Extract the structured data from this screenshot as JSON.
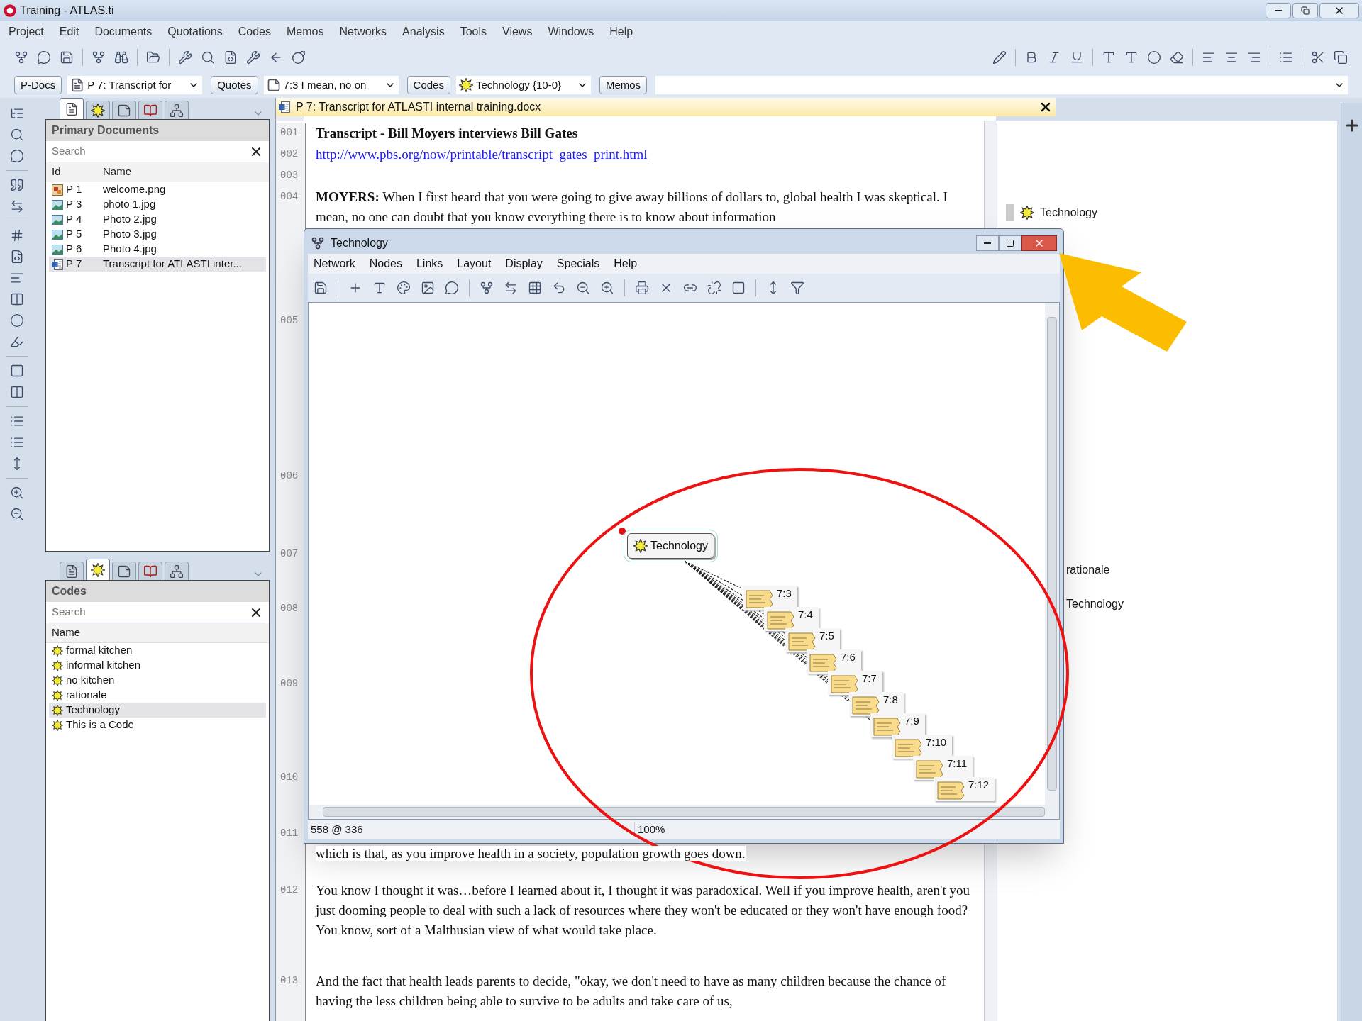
{
  "window": {
    "title": "Training - ATLAS.ti"
  },
  "menu": [
    "Project",
    "Edit",
    "Documents",
    "Quotations",
    "Codes",
    "Memos",
    "Networks",
    "Analysis",
    "Tools",
    "Views",
    "Windows",
    "Help"
  ],
  "selector_bar": [
    {
      "button": "P-Docs",
      "combo": "P 7: Transcript for"
    },
    {
      "button": "Quotes",
      "combo": "7:3 I mean, no on"
    },
    {
      "button": "Codes",
      "combo": "Technology {10-0}"
    },
    {
      "button": "Memos"
    }
  ],
  "primary_documents": {
    "tabs": [
      {
        "kind": "documents",
        "selected": true
      },
      {
        "kind": "codes",
        "selected": false
      },
      {
        "kind": "quotations",
        "selected": false
      },
      {
        "kind": "memos",
        "selected": false
      },
      {
        "kind": "networks",
        "selected": false
      }
    ],
    "title": "Primary Documents",
    "search": {
      "placeholder": "Search"
    },
    "columns": [
      "Id",
      "Name"
    ],
    "rows": [
      {
        "id": "P 1",
        "name": "welcome.png",
        "kind": "graphic",
        "selected": false
      },
      {
        "id": "P 3",
        "name": "photo 1.jpg",
        "kind": "image",
        "selected": false
      },
      {
        "id": "P 4",
        "name": "Photo 2.jpg",
        "kind": "image",
        "selected": false
      },
      {
        "id": "P 5",
        "name": "Photo 3.jpg",
        "kind": "image",
        "selected": false
      },
      {
        "id": "P 6",
        "name": "Photo 4.jpg",
        "kind": "image",
        "selected": false
      },
      {
        "id": "P 7",
        "name": "Transcript for ATLASTI inter...",
        "kind": "document",
        "selected": true
      }
    ]
  },
  "codes": {
    "tabs": [
      {
        "kind": "documents",
        "selected": false
      },
      {
        "kind": "codes",
        "selected": true
      },
      {
        "kind": "quotations",
        "selected": false
      },
      {
        "kind": "memos",
        "selected": false
      },
      {
        "kind": "networks",
        "selected": false
      }
    ],
    "title": "Codes",
    "search": {
      "placeholder": "Search"
    },
    "columns": [
      "Name"
    ],
    "rows": [
      {
        "name": "formal kitchen",
        "selected": false
      },
      {
        "name": "informal kitchen",
        "selected": false
      },
      {
        "name": "no kitchen",
        "selected": false
      },
      {
        "name": "rationale",
        "selected": false
      },
      {
        "name": "Technology",
        "selected": true
      },
      {
        "name": "This is a Code",
        "selected": false
      }
    ]
  },
  "document": {
    "title": "P 7: Transcript for ATLASTI internal training.docx",
    "lines": [
      {
        "number": "001",
        "kind": "heading",
        "text": "Transcript - Bill Moyers interviews Bill Gates"
      },
      {
        "number": "002",
        "kind": "link",
        "text": "http://www.pbs.org/now/printable/transcript_gates_print.html"
      },
      {
        "number": "003"
      },
      {
        "number": "004",
        "kind": "text",
        "text": "**MOYERS:** When I first heard that you were going to give away billions of dollars to, global health I was skeptical. I mean, no one can doubt that you know everything there is to know about information"
      },
      {
        "number": "005"
      },
      {
        "number": "006"
      },
      {
        "number": "007"
      },
      {
        "number": "008"
      },
      {
        "number": "009"
      },
      {
        "number": "010"
      },
      {
        "number": "011",
        "kind": "continued",
        "text": "which is that, as you improve health in a society, population growth goes down."
      },
      {
        "number": "012",
        "kind": "text",
        "text": "You know I thought it was…before I learned about it, I thought it was paradoxical. Well if you improve health, aren't you just dooming people to deal with such a lack of resources where they won't be educated or they won't have enough food? You know, sort of a Malthusian view of what would take place."
      },
      {
        "number": "013",
        "kind": "text",
        "text": "And the fact that health leads parents to decide, \"okay, we don't need to have as many children because the chance of having the less children being able to survive to be adults and take care of us,"
      }
    ]
  },
  "margin": [
    {
      "kind": "code",
      "text": "Technology"
    },
    {
      "kind": "plain",
      "text": "rationale"
    },
    {
      "kind": "plain",
      "text": "Technology"
    }
  ],
  "network_window": {
    "title": "Technology",
    "menu": [
      "Network",
      "Nodes",
      "Links",
      "Layout",
      "Display",
      "Specials",
      "Help"
    ],
    "code_node": "Technology",
    "quotation_nodes": [
      "7:3",
      "7:4",
      "7:5",
      "7:6",
      "7:7",
      "7:8",
      "7:9",
      "7:10",
      "7:11",
      "7:12"
    ],
    "status": {
      "position": "558 @ 336",
      "zoom": "100%"
    }
  }
}
